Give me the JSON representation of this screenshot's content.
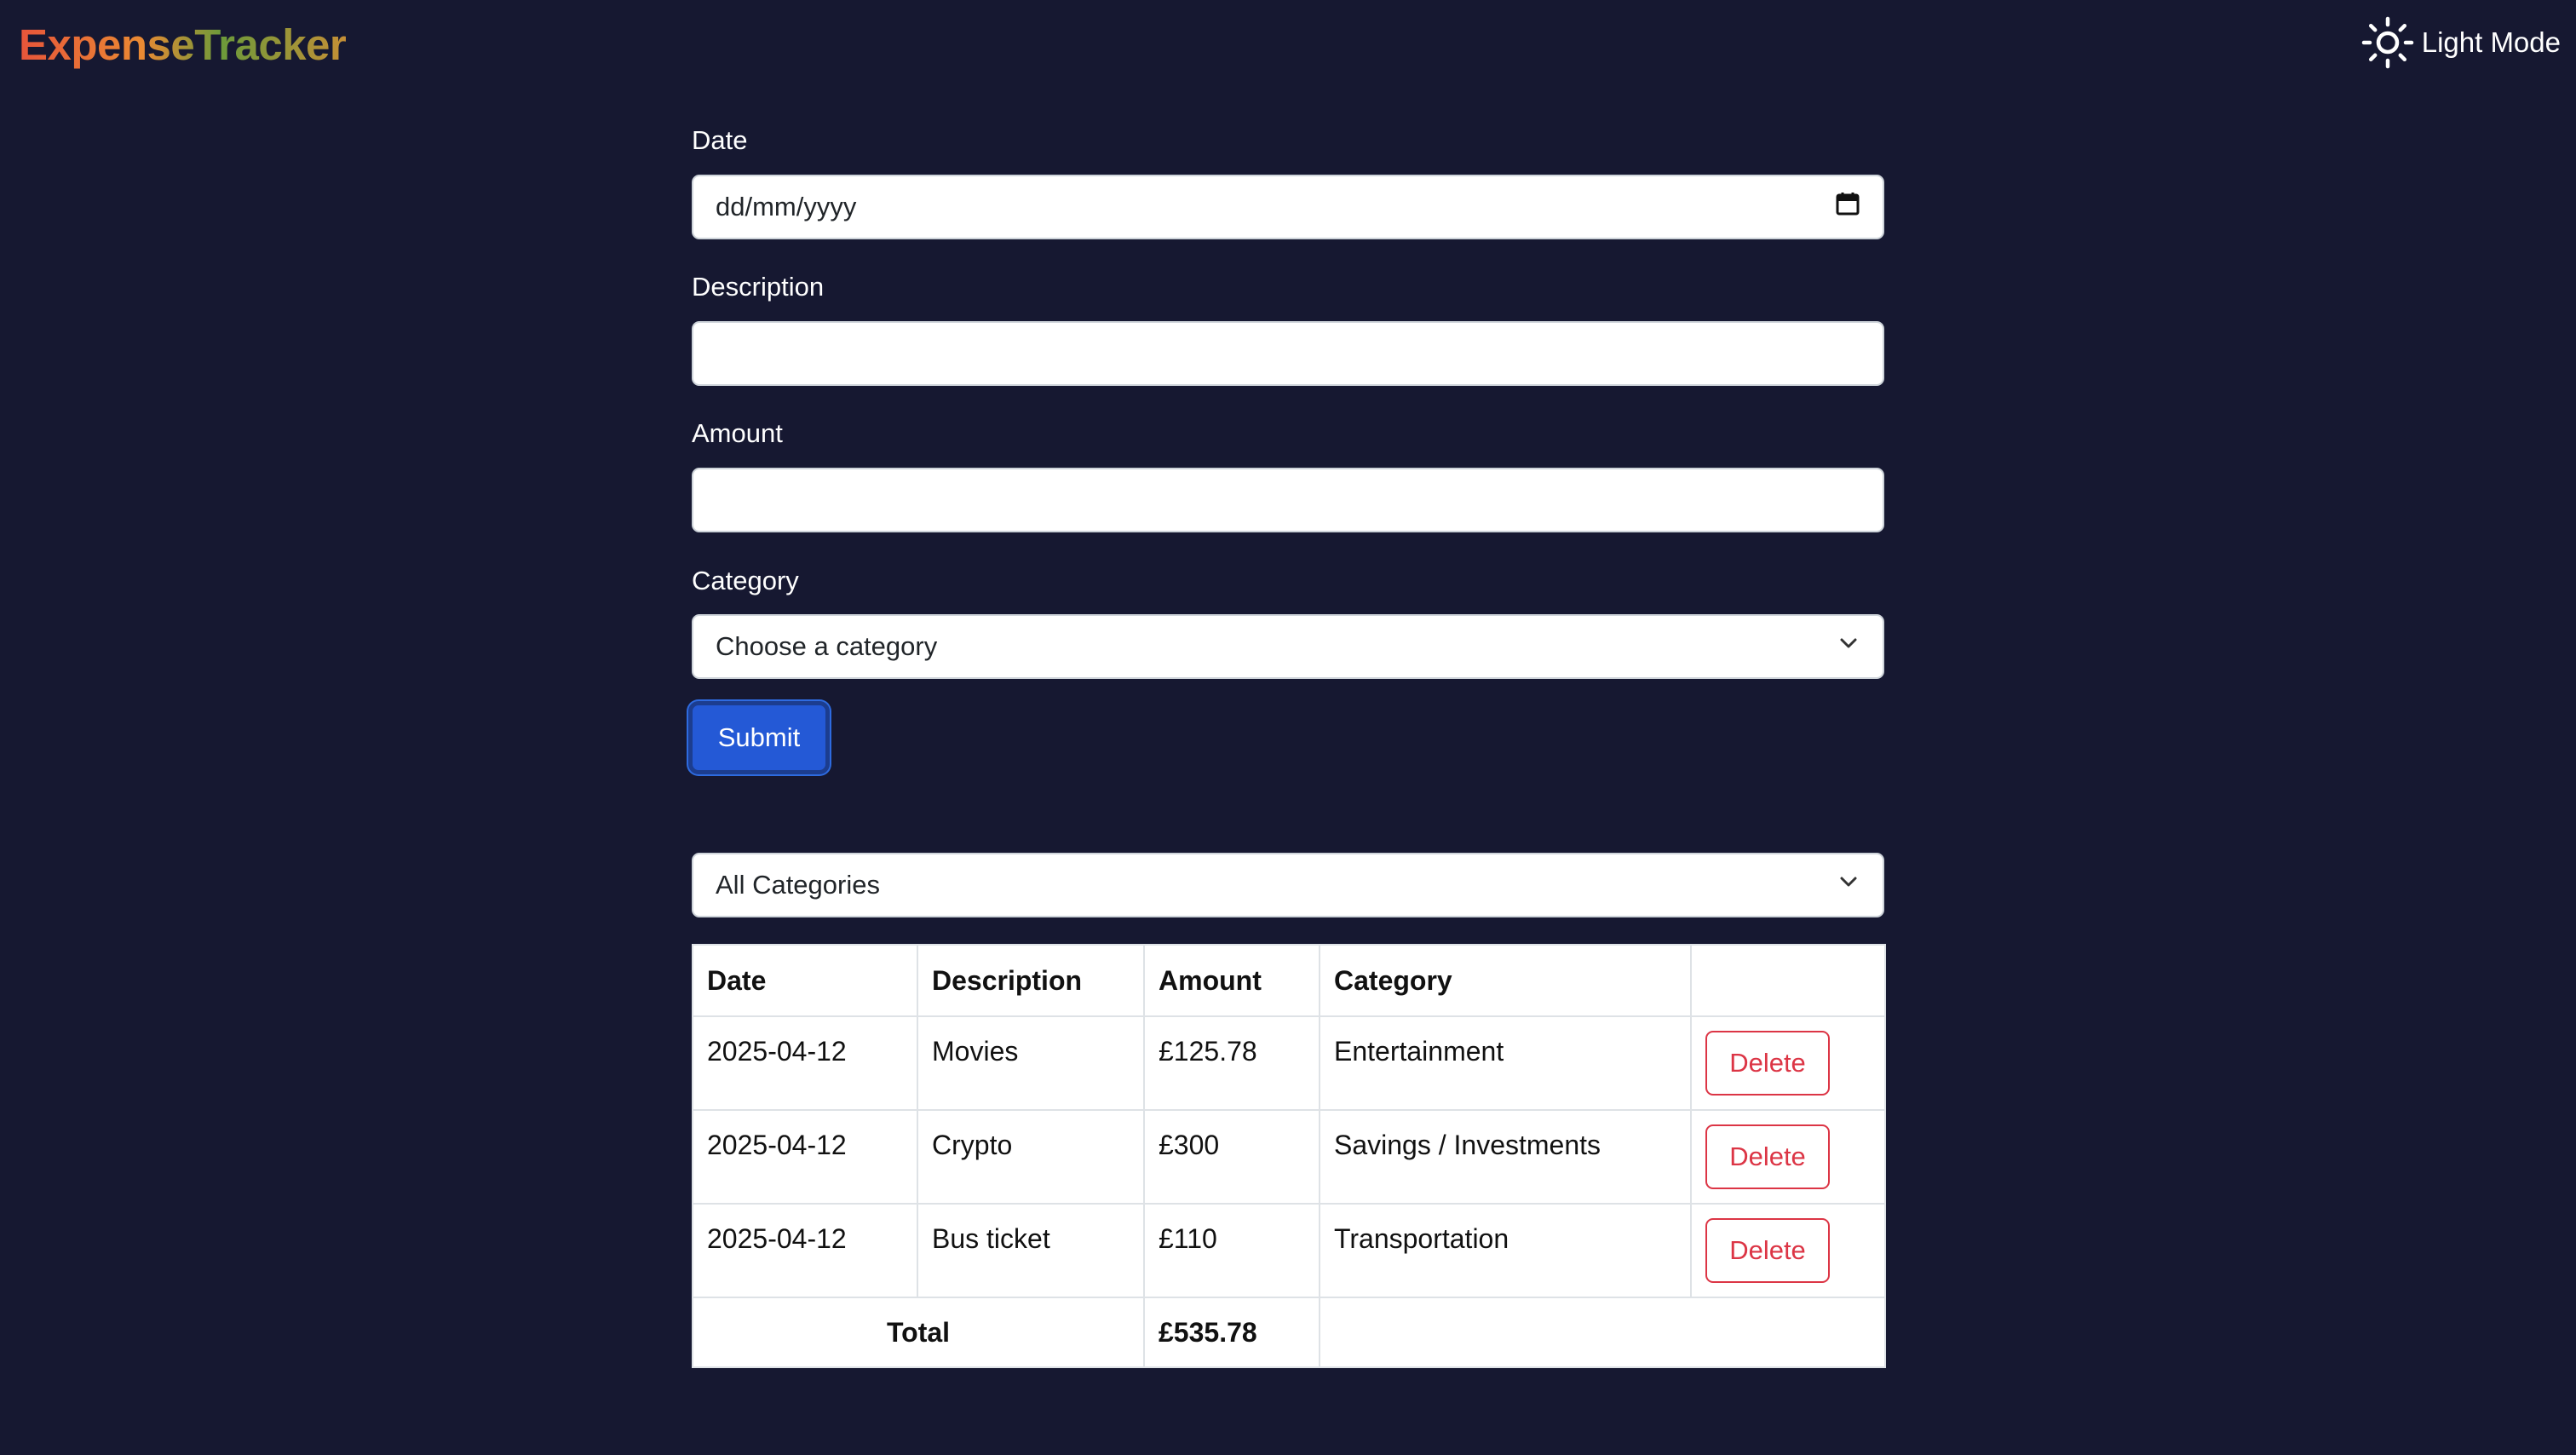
{
  "header": {
    "logo_text": "ExpenseTracker",
    "mode_toggle_label": "Light Mode",
    "mode_icon": "sun-icon"
  },
  "form": {
    "date_label": "Date",
    "date_placeholder": "dd/mm/yyyy",
    "description_label": "Description",
    "description_value": "",
    "amount_label": "Amount",
    "amount_value": "",
    "category_label": "Category",
    "category_selected": "Choose a category",
    "submit_label": "Submit"
  },
  "filter": {
    "selected": "All Categories"
  },
  "table": {
    "headers": [
      "Date",
      "Description",
      "Amount",
      "Category",
      ""
    ],
    "rows": [
      {
        "date": "2025-04-12",
        "description": "Movies",
        "amount": "£125.78",
        "category": "Entertainment",
        "action": "Delete"
      },
      {
        "date": "2025-04-12",
        "description": "Crypto",
        "amount": "£300",
        "category": "Savings / Investments",
        "action": "Delete"
      },
      {
        "date": "2025-04-12",
        "description": "Bus ticket",
        "amount": "£110",
        "category": "Transportation",
        "action": "Delete"
      }
    ],
    "total_label": "Total",
    "total_value": "£535.78"
  },
  "colors": {
    "background": "#161831",
    "primary_button": "#2459d6",
    "danger": "#dc3545",
    "logo_gradient": [
      "#e8553a",
      "#e98a33",
      "#6c9a3a",
      "#c58f36"
    ]
  }
}
